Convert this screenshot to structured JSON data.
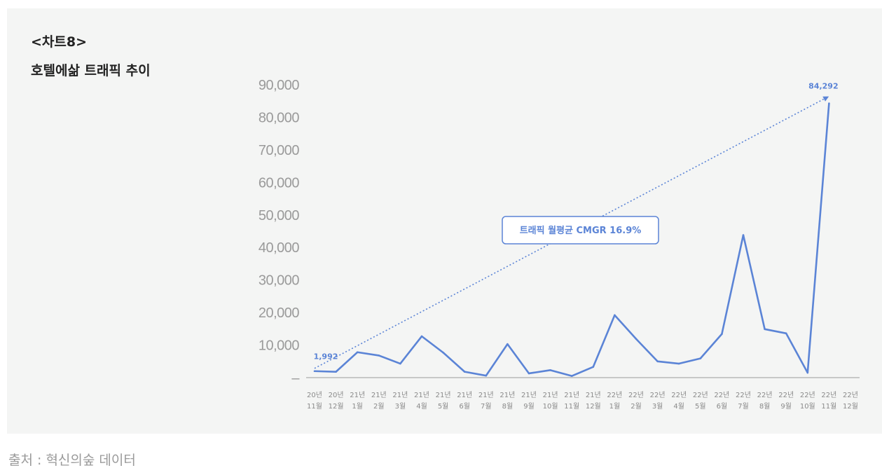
{
  "header": {
    "chart_number": "<차트8>",
    "title": "호텔에삶 트래픽 추이"
  },
  "footer": {
    "source": "출처 : 혁신의숲 데이터"
  },
  "colors": {
    "line": "#5b84d6",
    "panel_bg": "#f4f5f4",
    "axis_text": "#9a9a9a"
  },
  "chart_data": {
    "type": "line",
    "title": "호텔에삶 트래픽 추이",
    "categories": [
      [
        "20년",
        "11월"
      ],
      [
        "20년",
        "12월"
      ],
      [
        "21년",
        "1월"
      ],
      [
        "21년",
        "2월"
      ],
      [
        "21년",
        "3월"
      ],
      [
        "21년",
        "4월"
      ],
      [
        "21년",
        "5월"
      ],
      [
        "21년",
        "6월"
      ],
      [
        "21년",
        "7월"
      ],
      [
        "21년",
        "8월"
      ],
      [
        "21년",
        "9월"
      ],
      [
        "21년",
        "10월"
      ],
      [
        "21년",
        "11월"
      ],
      [
        "21년",
        "12월"
      ],
      [
        "22년",
        "1월"
      ],
      [
        "22년",
        "2월"
      ],
      [
        "22년",
        "3월"
      ],
      [
        "22년",
        "4월"
      ],
      [
        "22년",
        "5월"
      ],
      [
        "22년",
        "6월"
      ],
      [
        "22년",
        "7월"
      ],
      [
        "22년",
        "8월"
      ],
      [
        "22년",
        "9월"
      ],
      [
        "22년",
        "10월"
      ],
      [
        "22년",
        "11월"
      ],
      [
        "22년",
        "12월"
      ]
    ],
    "series": [
      {
        "values": [
          1992,
          1800,
          7800,
          6800,
          4300,
          12700,
          7700,
          1800,
          600,
          10300,
          1300,
          2300,
          500,
          3300,
          19200,
          11900,
          5000,
          4300,
          5900,
          13400,
          43800,
          14900,
          13600,
          1500,
          84292
        ]
      }
    ],
    "ylim": [
      0,
      90000
    ],
    "yticks": [
      "–",
      "10,000",
      "20,000",
      "30,000",
      "40,000",
      "50,000",
      "60,000",
      "70,000",
      "80,000",
      "90,000"
    ],
    "grid": false,
    "data_labels": {
      "first": "1,992",
      "last": "84,292"
    },
    "trend_line": {
      "from_value": 1992,
      "to_value": 84292,
      "annotation": "트래픽 월평균 CMGR 16.9%"
    }
  }
}
